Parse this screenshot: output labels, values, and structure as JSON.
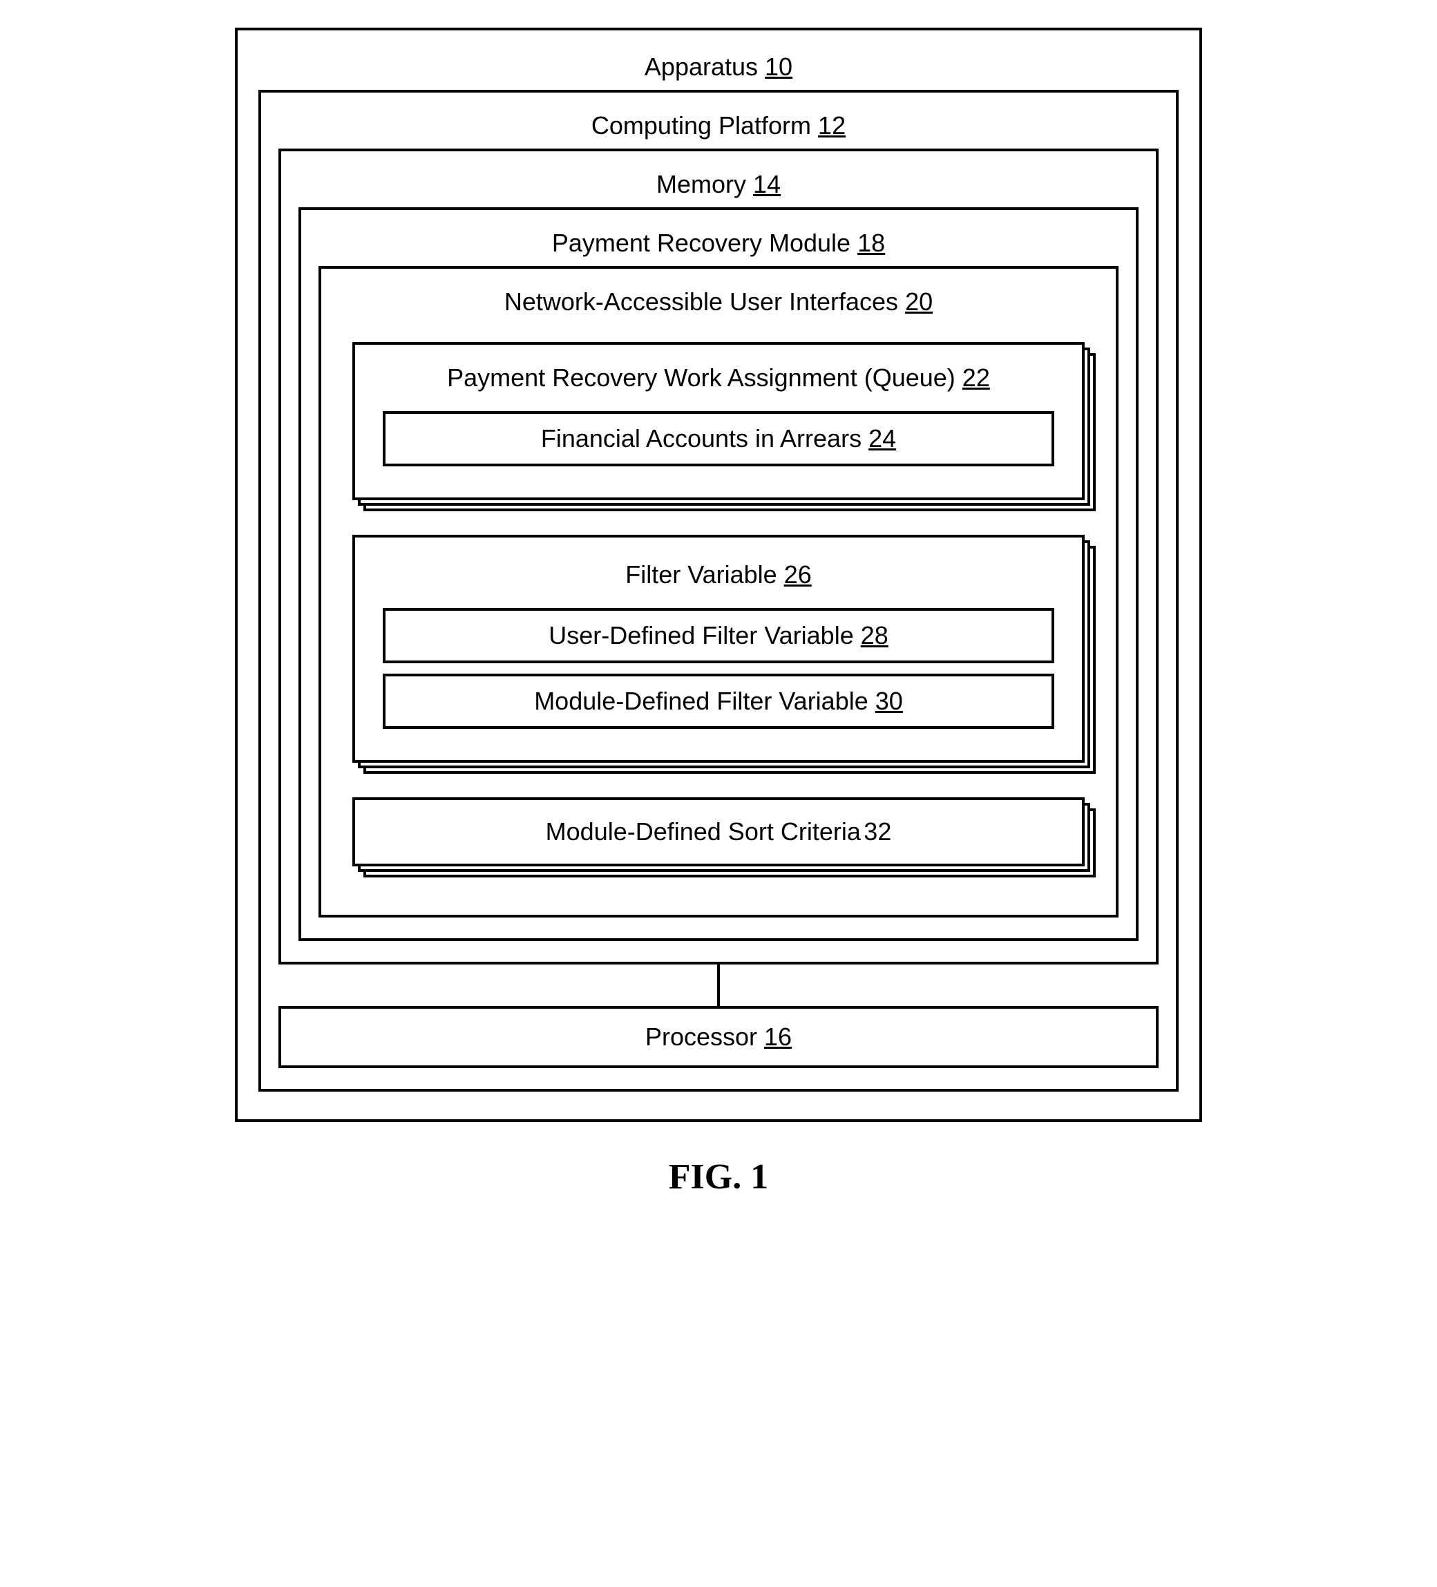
{
  "apparatus": {
    "label": "Apparatus",
    "ref": "10"
  },
  "computing_platform": {
    "label": "Computing Platform",
    "ref": "12"
  },
  "memory": {
    "label": "Memory",
    "ref": "14"
  },
  "payment_recovery": {
    "label": "Payment Recovery Module",
    "ref": "18"
  },
  "network_ui": {
    "label": "Network-Accessible User Interfaces",
    "ref": "20"
  },
  "queue": {
    "label": "Payment Recovery Work Assignment (Queue)",
    "ref": "22"
  },
  "accounts": {
    "label": "Financial Accounts in Arrears",
    "ref": "24"
  },
  "filter_variable": {
    "label": "Filter Variable",
    "ref": "26"
  },
  "user_filter": {
    "label": "User-Defined Filter Variable",
    "ref": "28"
  },
  "module_filter": {
    "label": "Module-Defined Filter Variable",
    "ref": "30"
  },
  "sort_criteria": {
    "label": "Module-Defined Sort Criteria",
    "ref": "32"
  },
  "processor": {
    "label": "Processor",
    "ref": "16"
  },
  "figure_caption": "FIG. 1"
}
